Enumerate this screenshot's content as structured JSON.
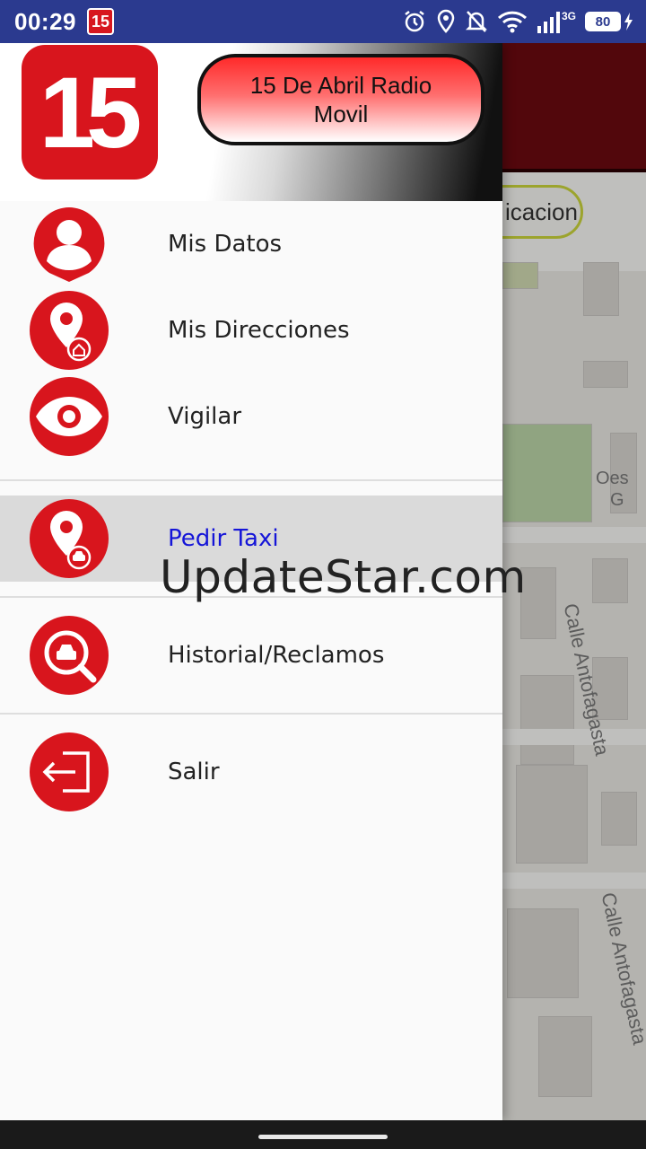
{
  "status_bar": {
    "time": "00:29",
    "notification_badge": "15",
    "network_type": "3G",
    "battery_level": "80",
    "icons": [
      "alarm-icon",
      "location-icon",
      "bell-off-icon",
      "wifi-icon",
      "signal-icon",
      "battery-icon",
      "charging-icon"
    ]
  },
  "background_app": {
    "location_button_partial": "icacion",
    "streets": [
      "Calle Antofagasta",
      "Calle Antofagasta"
    ],
    "map_label_partial_1": "Oes",
    "map_label_partial_2": "G"
  },
  "drawer": {
    "logo_text": "15",
    "app_title": "15 De Abril Radio Movil",
    "menu": [
      {
        "label": "Mis Datos",
        "icon": "user-icon"
      },
      {
        "label": "Mis Direcciones",
        "icon": "home-pin-icon"
      },
      {
        "label": "Vigilar",
        "icon": "eye-icon"
      },
      {
        "label": "Pedir Taxi",
        "icon": "taxi-pin-icon",
        "selected": true
      },
      {
        "label": "Historial/Reclamos",
        "icon": "taxi-search-icon"
      },
      {
        "label": "Salir",
        "icon": "logout-icon"
      }
    ]
  },
  "watermark": "UpdateStar.com",
  "colors": {
    "brand_red": "#d8151d",
    "status_bar": "#2b3a8f",
    "header_dark_red": "#6a0a10",
    "selected_text": "#1515d8"
  }
}
